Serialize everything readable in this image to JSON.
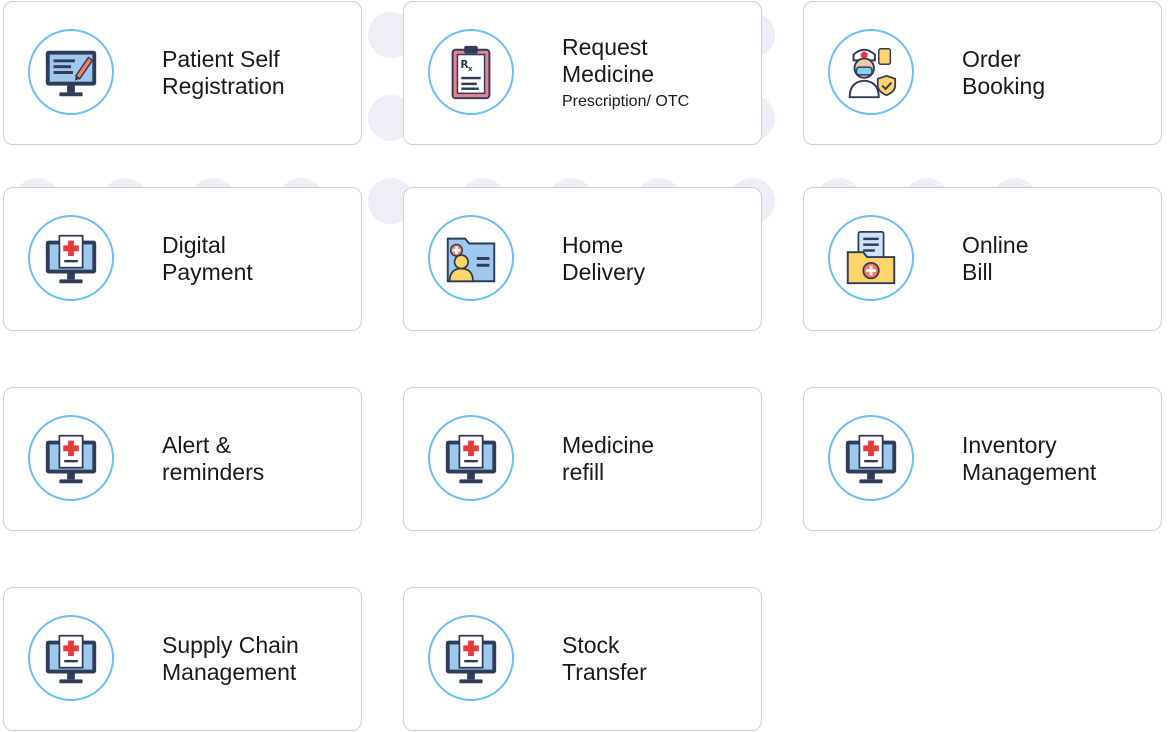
{
  "colors": {
    "ring": "#6cbff0",
    "card_border": "#cfcfcf",
    "text": "#1a1a1a",
    "monitor_screen": "#9ec8ee",
    "monitor_frame": "#2f3b57",
    "cross": "#e83a3a",
    "folder": "#ffd56b",
    "receipt": "#cfe2f8"
  },
  "cards": [
    {
      "icon": "computer-edit-icon",
      "line1": "Patient Self",
      "line2": "Registration"
    },
    {
      "icon": "prescription-clipboard-icon",
      "line1": "Request",
      "line2": "Medicine",
      "sub": "Prescription/ OTC"
    },
    {
      "icon": "nurse-shield-icon",
      "line1": "Order",
      "line2": "Booking"
    },
    {
      "icon": "medical-monitor-icon",
      "line1": "Digital",
      "line2": "Payment"
    },
    {
      "icon": "patient-folder-icon",
      "line1": "Home",
      "line2": "Delivery"
    },
    {
      "icon": "bill-folder-icon",
      "line1": "Online",
      "line2": "Bill"
    },
    {
      "icon": "medical-monitor-icon",
      "line1": "Alert &",
      "line2": "reminders"
    },
    {
      "icon": "medical-monitor-icon",
      "line1": "Medicine",
      "line2": "refill"
    },
    {
      "icon": "medical-monitor-icon",
      "line1": "Inventory",
      "line2": "Management"
    },
    {
      "icon": "medical-monitor-icon",
      "line1": "Supply Chain",
      "line2": "Management"
    },
    {
      "icon": "medical-monitor-icon",
      "line1": "Stock",
      "line2": "Transfer"
    }
  ]
}
